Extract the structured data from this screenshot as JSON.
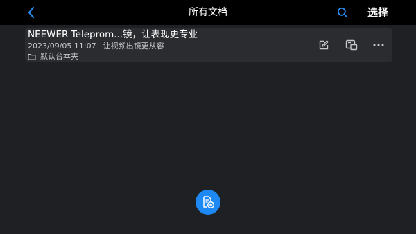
{
  "header": {
    "title": "所有文档",
    "select_label": "选择",
    "back_icon": "chevron-left-icon",
    "search_icon": "search-icon"
  },
  "documents": [
    {
      "title": "NEEWER Teleprom...镜，让表现更专业",
      "date": "2023/09/05 11:07",
      "snippet": "让视频出镜更从容",
      "folder": "默认台本夹"
    }
  ],
  "card_actions": [
    "edit-icon",
    "teleprompter-preview-icon",
    "more-icon"
  ],
  "fab": {
    "icon": "new-document-icon"
  },
  "colors": {
    "background": "#1f2023",
    "topbar": "#000000",
    "card": "#2a2c2f",
    "accent": "#1e88f5",
    "secondary_text": "#c7c9cc"
  }
}
